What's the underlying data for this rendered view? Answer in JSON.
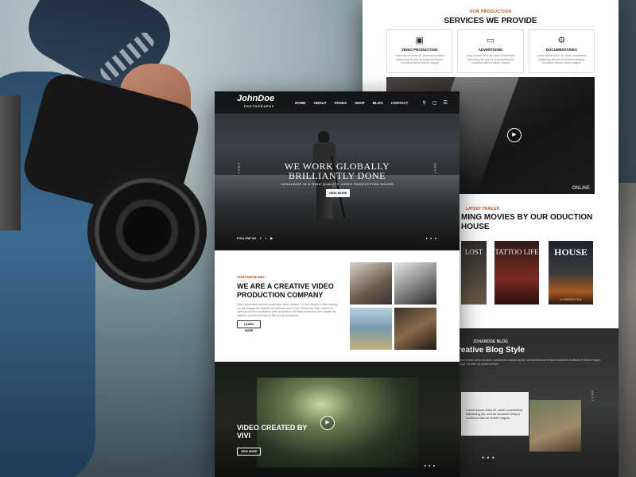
{
  "services": {
    "overline": "OUR PRODUCTION",
    "title": "SERVICES WE PROVIDE",
    "cards": [
      {
        "icon": "box-icon",
        "name": "VIDEO PRODUCTION",
        "text": "Lorem ipsum dolor sit, amet consectetur adipiscing elit sed do eiusmod tempor incididunt labore dolore magna"
      },
      {
        "icon": "monitor-icon",
        "name": "ADVERTISING",
        "text": "Lorem ipsum dolor sit, amet consectetur adipiscing elit sed do eiusmod tempor incididunt labore dolore magna"
      },
      {
        "icon": "film-icon",
        "name": "DOCUMENTARIES",
        "text": "Lorem ipsum dolor sit, amet consectetur adipiscing elit sed do eiusmod tempor incididunt labore dolore magna"
      }
    ],
    "studio_overlay": "ONLINE"
  },
  "trailer": {
    "overline": "LATEST TRAILER",
    "title": "MING MOVIES BY OUR ODUCTION HOUSE",
    "posters": [
      {
        "title": "LOST",
        "bottom": ""
      },
      {
        "title": "TATTOO LIFE",
        "bottom": ""
      },
      {
        "title": "HOUSE",
        "bottom": "A HORROR FILM"
      }
    ]
  },
  "blog": {
    "overline": "JOHANDOE BLOG",
    "title": "reative Blog Style",
    "desc": "Lorem ipsum dolor sit amet, consectetur adipiscing elit, sed do eiusmod tempor incididunt ut labore et dolore magna aliqua. Ut enim ad minim veniam.",
    "next": "NEXT",
    "card_text": "Lorem ipsum dolor sit, amet consectetur adipiscing elit, sed do eiusmod tempor incididunt labore dolore magna"
  },
  "nav": {
    "logo": "JohnDoe",
    "logo_sub": "PHOTOGRAPHY",
    "items": [
      "HOME",
      "ABOUT",
      "PAGES",
      "SHOP",
      "BLOG",
      "CONTACT"
    ]
  },
  "hero": {
    "title_line1": "WE WORK GLOBALLY",
    "title_line2": "BRILLIANTLY DONE",
    "subtitle": "JOHANDOE IS A HIGH QUALITY VIDEO PRODUCTION HOUSE",
    "button": "VIEW MORE",
    "prev": "PREV",
    "next": "NEXT",
    "follow": "FOLLOW US"
  },
  "bio": {
    "overline": "JOHANDOE BIO",
    "title": "WE ARE A CREATIVE VIDEO PRODUCTION COMPANY",
    "text": "Video production with the production value version 1 of the designs of film making, our the images the highest we achieved from 2013. These are Video Sense of video production production year production and work production film images art, digitally recorded formats of film movie production.",
    "button": "LEARN MORE"
  },
  "video": {
    "title": "VIDEO CREATED BY VIVI",
    "button": "VIEW MORE"
  },
  "colors": {
    "accent": "#c0501e",
    "dark": "#151616"
  }
}
